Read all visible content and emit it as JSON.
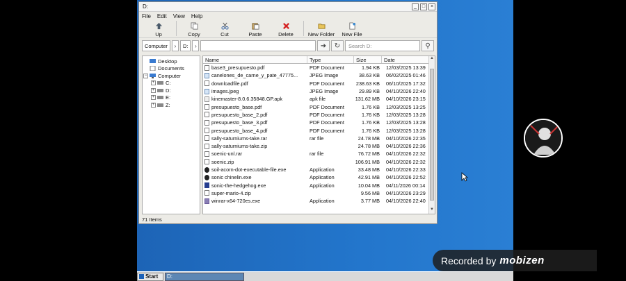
{
  "window": {
    "title": "D:",
    "controls": [
      "_",
      "□",
      "×"
    ]
  },
  "menu": [
    "File",
    "Edit",
    "View",
    "Help"
  ],
  "toolbar": [
    {
      "label": "Up",
      "icon": "up-arrow-icon"
    },
    {
      "label": "Copy",
      "icon": "copy-icon"
    },
    {
      "label": "Cut",
      "icon": "scissors-icon"
    },
    {
      "label": "Paste",
      "icon": "paste-icon"
    },
    {
      "label": "Delete",
      "icon": "delete-icon"
    },
    {
      "label": "New Folder",
      "icon": "new-folder-icon"
    },
    {
      "label": "New File",
      "icon": "new-file-icon"
    }
  ],
  "address": {
    "crumb1": "Computer",
    "crumb2": "D:",
    "search_placeholder": "Search D:"
  },
  "tree": [
    {
      "label": "Desktop",
      "level": 1
    },
    {
      "label": "Documents",
      "level": 1
    },
    {
      "label": "Computer",
      "level": 0
    },
    {
      "label": "C:",
      "level": 2
    },
    {
      "label": "D:",
      "level": 2
    },
    {
      "label": "E:",
      "level": 2
    },
    {
      "label": "Z:",
      "level": 2
    }
  ],
  "columns": {
    "name": "Name",
    "type": "Type",
    "size": "Size",
    "date": "Date"
  },
  "files": [
    {
      "name": "base3_presupuesto.pdf",
      "type": "PDF Document",
      "size": "1.94 KB",
      "date": "12/03/2025 13:39",
      "icon": "doc"
    },
    {
      "name": "canelones_de_carne_y_pate_47775...",
      "type": "JPEG Image",
      "size": "38.63 KB",
      "date": "06/02/2025 01:46",
      "icon": "img"
    },
    {
      "name": "downloadfile.pdf",
      "type": "PDF Document",
      "size": "238.63 KB",
      "date": "06/10/2025 17:32",
      "icon": "doc"
    },
    {
      "name": "images.jpeg",
      "type": "JPEG Image",
      "size": "29.89 KB",
      "date": "04/10/2026 22:40",
      "icon": "img"
    },
    {
      "name": "kinemaster-8.0.6.35848.GP.apk",
      "type": "apk file",
      "size": "131.62 MB",
      "date": "04/10/2026 23:15",
      "icon": "apk"
    },
    {
      "name": "presupuesto_base.pdf",
      "type": "PDF Document",
      "size": "1.76 KB",
      "date": "12/03/2025 13:25",
      "icon": "doc"
    },
    {
      "name": "presupuesto_base_2.pdf",
      "type": "PDF Document",
      "size": "1.76 KB",
      "date": "12/03/2025 13:28",
      "icon": "doc"
    },
    {
      "name": "presupuesto_base_3.pdf",
      "type": "PDF Document",
      "size": "1.76 KB",
      "date": "12/03/2025 13:28",
      "icon": "doc"
    },
    {
      "name": "presupuesto_base_4.pdf",
      "type": "PDF Document",
      "size": "1.76 KB",
      "date": "12/03/2025 13:28",
      "icon": "doc"
    },
    {
      "name": "sally-saturniums-take.rar",
      "type": "rar file",
      "size": "24.78 MB",
      "date": "04/10/2026 22:35",
      "icon": "doc"
    },
    {
      "name": "sally-saturniums-take.zip",
      "type": "",
      "size": "24.78 MB",
      "date": "04/10/2026 22:36",
      "icon": "doc"
    },
    {
      "name": "soenic-unl.rar",
      "type": "rar file",
      "size": "76.72 MB",
      "date": "04/10/2026 22:32",
      "icon": "doc"
    },
    {
      "name": "soenic.zip",
      "type": "",
      "size": "106.91 MB",
      "date": "04/10/2026 22:32",
      "icon": "doc"
    },
    {
      "name": "soil-acorn-dot-executable-file.exe",
      "type": "Application",
      "size": "33.48 MB",
      "date": "04/10/2026 22:33",
      "icon": "app"
    },
    {
      "name": "sonic chinelin.exe",
      "type": "Application",
      "size": "42.91 MB",
      "date": "04/10/2026 22:52",
      "icon": "app"
    },
    {
      "name": "sonic-the-hedgehog.exe",
      "type": "Application",
      "size": "10.04 MB",
      "date": "04/11/2026 00:14",
      "icon": "app2"
    },
    {
      "name": "super-mario-4.zip",
      "type": "",
      "size": "9.56 MB",
      "date": "04/10/2026 23:29",
      "icon": "doc"
    },
    {
      "name": "winrar-x64-720es.exe",
      "type": "Application",
      "size": "3.77 MB",
      "date": "04/10/2026 22:40",
      "icon": "arc"
    }
  ],
  "status": "71 Items",
  "taskbar": {
    "start": "Start",
    "item": "D:"
  },
  "overlay": {
    "recorded_by": "Recorded by",
    "brand": "mobizen"
  },
  "colors": {
    "desktop": "#1f6bbd",
    "taskbar_item": "#5d87b4"
  }
}
